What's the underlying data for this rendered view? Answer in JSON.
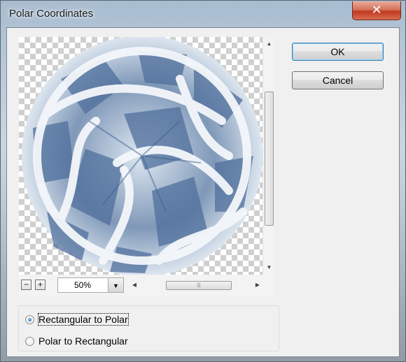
{
  "window": {
    "title": "Polar Coordinates",
    "close_label": "✕"
  },
  "buttons": {
    "ok_label": "OK",
    "cancel_label": "Cancel"
  },
  "preview": {
    "zoom_out_label": "−",
    "zoom_in_label": "+",
    "zoom_value": "50%"
  },
  "options": {
    "items": [
      {
        "label": "Rectangular to Polar",
        "selected": true
      },
      {
        "label": "Polar to Rectangular",
        "selected": false
      }
    ]
  },
  "colors": {
    "accent": "#3c7fb1",
    "preview_blue": "#5b7aa6",
    "preview_white": "#eef3f8"
  }
}
